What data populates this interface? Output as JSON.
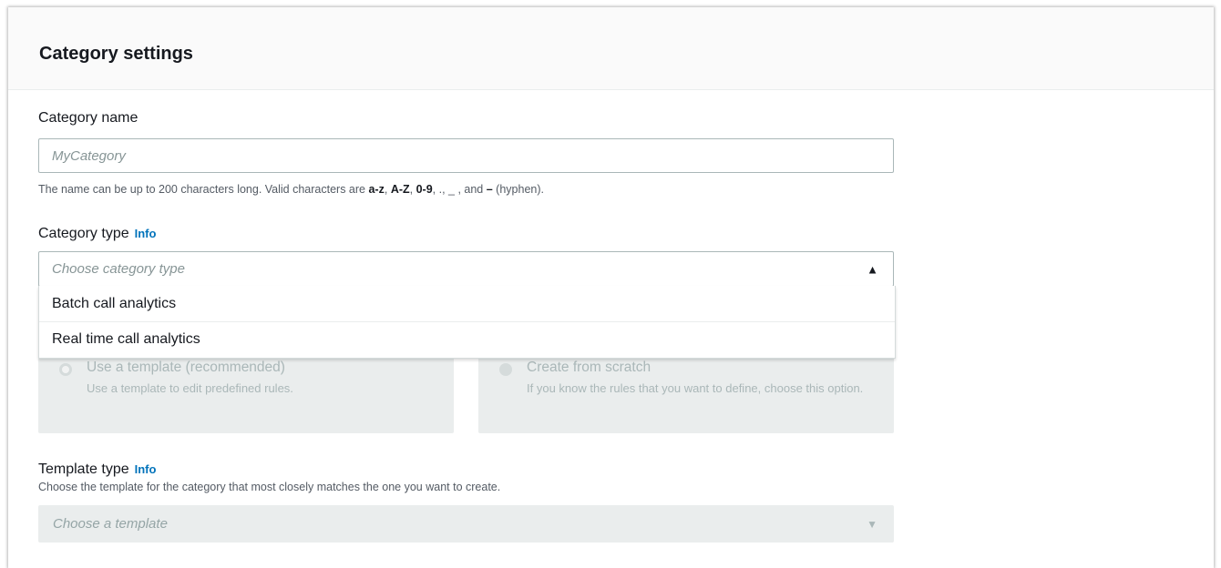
{
  "panel": {
    "title": "Category settings"
  },
  "category_name": {
    "label": "Category name",
    "placeholder": "MyCategory",
    "hint_prefix": "The name can be up to 200 characters long. Valid characters are ",
    "hint_range1": "a-z",
    "hint_sep1": ", ",
    "hint_range2": "A-Z",
    "hint_sep2": ", ",
    "hint_range3": "0-9",
    "hint_sep3": ", ., _ , and ",
    "hint_range4": "–",
    "hint_suffix": " (hyphen)."
  },
  "category_type": {
    "label": "Category type",
    "info": "Info",
    "placeholder": "Choose category type",
    "options": [
      {
        "label": "Batch call analytics"
      },
      {
        "label": "Real time call analytics"
      }
    ]
  },
  "creation_method": {
    "template": {
      "title": "Use a template (recommended)",
      "description": "Use a template to edit predefined rules."
    },
    "scratch": {
      "title": "Create from scratch",
      "description": "If you know the rules that you want to define, choose this option."
    }
  },
  "template_type": {
    "label": "Template type",
    "info": "Info",
    "description": "Choose the template for the category that most closely matches the one you want to create.",
    "placeholder": "Choose a template"
  },
  "icons": {
    "expanded": "caret-up-icon",
    "collapsed": "caret-down-icon"
  },
  "colors": {
    "link": "#0073bb",
    "text": "#16191f",
    "disabled_bg": "#eaeded"
  }
}
